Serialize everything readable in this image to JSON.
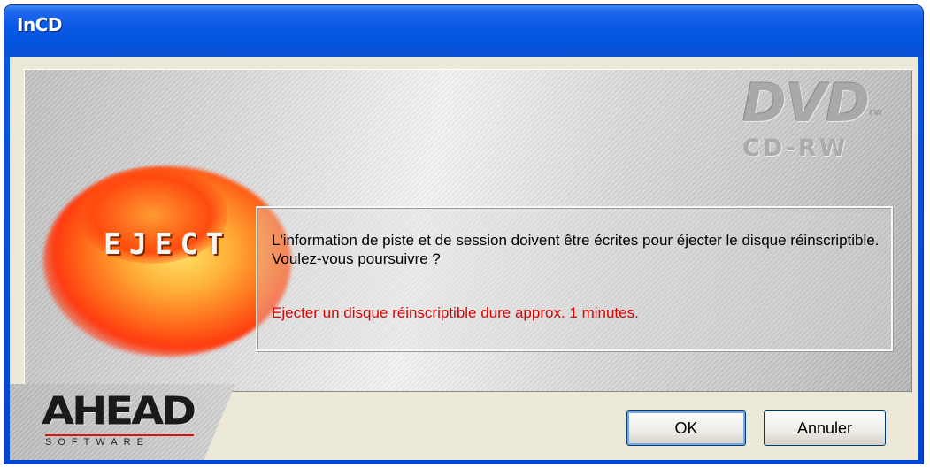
{
  "window": {
    "title": "InCD"
  },
  "banner": {
    "eject_label": "EJECT",
    "dvd_label": "DVD",
    "tm_label": "rw",
    "cdrw_label": "CD-RW"
  },
  "message": {
    "main": "L'information de piste et de session doivent être écrites pour éjecter le disque réinscriptible. Voulez-vous poursuivre ?",
    "warning": "Ejecter un disque réinscriptible dure approx. 1 minutes."
  },
  "logo": {
    "name": "AHEAD",
    "tagline": "SOFTWARE"
  },
  "buttons": {
    "ok": "OK",
    "cancel": "Annuler"
  },
  "colors": {
    "titlebar": "#0a59e0",
    "warning_text": "#e00000",
    "client_bg": "#ece9d8"
  }
}
